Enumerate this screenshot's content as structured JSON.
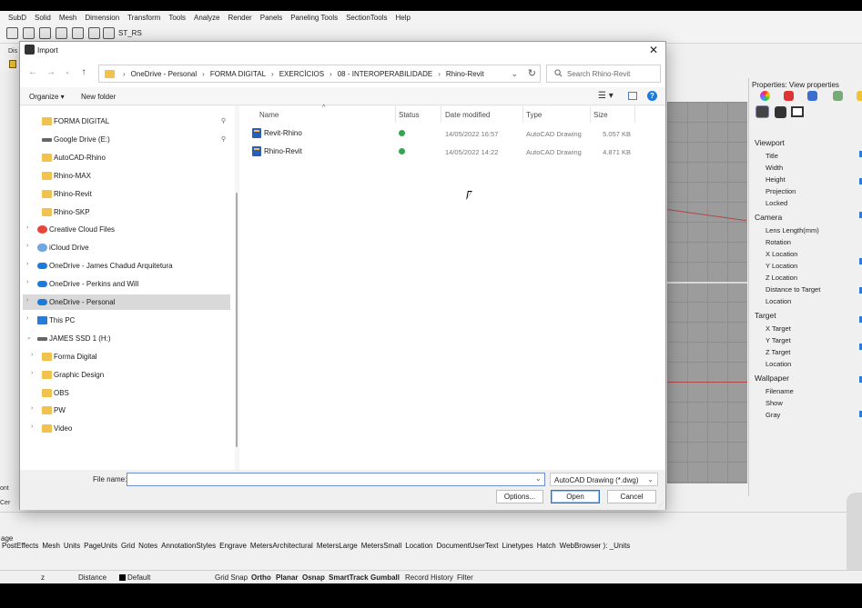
{
  "menubar": [
    "SubD",
    "Solid",
    "Mesh",
    "Dimension",
    "Transform",
    "Tools",
    "Analyze",
    "Render",
    "Panels",
    "Paneling Tools",
    "SectionTools",
    "Help"
  ],
  "toolbar": {
    "label": "ST_RS",
    "side_label": "Dis"
  },
  "properties": {
    "title": "Properties: View properties",
    "sections": [
      {
        "name": "Viewport",
        "rows": [
          "Title",
          "Width",
          "Height",
          "Projection",
          "Locked"
        ]
      },
      {
        "name": "Camera",
        "rows": [
          "Lens Length(mm)",
          "Rotation",
          "X Location",
          "Y Location",
          "Z Location",
          "Distance to Target",
          "Location"
        ]
      },
      {
        "name": "Target",
        "rows": [
          "X Target",
          "Y Target",
          "Z Target",
          "Location"
        ]
      },
      {
        "name": "Wallpaper",
        "rows": [
          "Filename",
          "Show",
          "Gray"
        ]
      }
    ]
  },
  "command": {
    "prefix": "age",
    "options": [
      "PostEffects",
      "Mesh",
      "Units",
      "PageUnits",
      "Grid",
      "Notes",
      "AnnotationStyles",
      "Engrave",
      "MetersArchitectural",
      "MetersLarge",
      "MetersSmall",
      "Location",
      "DocumentUserText",
      "Linetypes",
      "Hatch",
      "WebBrowser ): _Units"
    ]
  },
  "left_peek": [
    "ont",
    "Cer"
  ],
  "statusbar": {
    "z": "z",
    "distance": "Distance",
    "layer": "Default",
    "toggles": [
      {
        "label": "Grid Snap",
        "bold": false
      },
      {
        "label": "Ortho",
        "bold": true
      },
      {
        "label": "Planar",
        "bold": true
      },
      {
        "label": "Osnap",
        "bold": true
      },
      {
        "label": "SmartTrack",
        "bold": true
      },
      {
        "label": "Gumball",
        "bold": true
      },
      {
        "label": "Record History",
        "bold": false
      },
      {
        "label": "Filter",
        "bold": false
      }
    ]
  },
  "dialog": {
    "title": "Import",
    "close_glyph": "✕",
    "breadcrumb": [
      "OneDrive - Personal",
      "FORMA DIGITAL",
      "EXERCÍCIOS",
      "08 - INTEROPERABILIDADE",
      "Rhino-Revit"
    ],
    "search_placeholder": "Search Rhino-Revit",
    "organize": "Organize ▾",
    "new_folder": "New folder",
    "help_glyph": "?",
    "nav_items": [
      {
        "label": "FORMA DIGITAL",
        "icon": "folder",
        "pinned": true,
        "chevron": "",
        "indent": 1
      },
      {
        "label": "Google Drive (E:)",
        "icon": "drive",
        "pinned": true,
        "chevron": "",
        "indent": 1
      },
      {
        "label": "AutoCAD-Rhino",
        "icon": "folder",
        "pinned": false,
        "chevron": "",
        "indent": 1
      },
      {
        "label": "Rhino-MAX",
        "icon": "folder",
        "pinned": false,
        "chevron": "",
        "indent": 1
      },
      {
        "label": "Rhino-Revit",
        "icon": "folder",
        "pinned": false,
        "chevron": "",
        "indent": 1
      },
      {
        "label": "Rhino-SKP",
        "icon": "folder",
        "pinned": false,
        "chevron": "",
        "indent": 1
      },
      {
        "label": "Creative Cloud Files",
        "icon": "cc",
        "pinned": false,
        "chevron": "›",
        "indent": 0
      },
      {
        "label": "iCloud Drive",
        "icon": "icloud",
        "pinned": false,
        "chevron": "›",
        "indent": 0
      },
      {
        "label": "OneDrive - James Chadud Arquitetura",
        "icon": "cloud",
        "pinned": false,
        "chevron": "›",
        "indent": 0
      },
      {
        "label": "OneDrive - Perkins and Will",
        "icon": "cloud",
        "pinned": false,
        "chevron": "›",
        "indent": 0
      },
      {
        "label": "OneDrive - Personal",
        "icon": "cloud",
        "pinned": false,
        "chevron": "›",
        "indent": 0,
        "selected": true
      },
      {
        "label": "This PC",
        "icon": "pc",
        "pinned": false,
        "chevron": "›",
        "indent": 0
      },
      {
        "label": "JAMES SSD 1 (H:)",
        "icon": "drive",
        "pinned": false,
        "chevron": "⌄",
        "indent": 0
      },
      {
        "label": "Forma Digital",
        "icon": "folder",
        "pinned": false,
        "chevron": "›",
        "indent": 1
      },
      {
        "label": "Graphic Design",
        "icon": "folder",
        "pinned": false,
        "chevron": "›",
        "indent": 1
      },
      {
        "label": "OBS",
        "icon": "folder",
        "pinned": false,
        "chevron": "",
        "indent": 1
      },
      {
        "label": "PW",
        "icon": "folder",
        "pinned": false,
        "chevron": "›",
        "indent": 1
      },
      {
        "label": "Video",
        "icon": "folder",
        "pinned": false,
        "chevron": "›",
        "indent": 1
      }
    ],
    "columns": {
      "name": "Name",
      "status": "Status",
      "date": "Date modified",
      "type": "Type",
      "size": "Size"
    },
    "files": [
      {
        "name": "Revit-Rhino",
        "date": "14/05/2022 16:57",
        "type": "AutoCAD Drawing",
        "size": "5.057 KB"
      },
      {
        "name": "Rhino-Revit",
        "date": "14/05/2022 14:22",
        "type": "AutoCAD Drawing",
        "size": "4.871 KB"
      }
    ],
    "file_name_label": "File name:",
    "file_name_value": "",
    "filter": "AutoCAD Drawing (*.dwg)",
    "buttons": {
      "options": "Options...",
      "open": "Open",
      "cancel": "Cancel"
    }
  },
  "colors": {
    "folder": "#f2c14e",
    "cloud": "#1c7ad9",
    "status_ok": "#2fa84f",
    "accent": "#2f6fc4"
  }
}
